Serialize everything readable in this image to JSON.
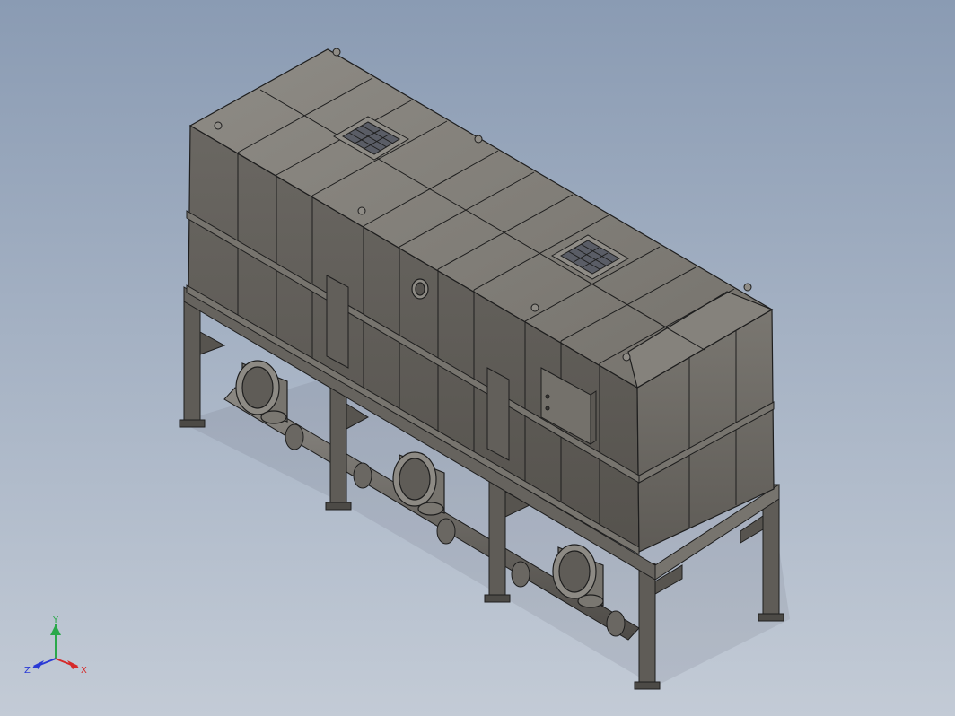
{
  "viewport": {
    "background_top": "#8a9bb3",
    "background_bottom": "#c3cbd6"
  },
  "model": {
    "body_color": "#6e6b66",
    "edge_color": "#1e1e1e"
  },
  "triad": {
    "x_label": "X",
    "y_label": "Y",
    "z_label": "Z",
    "x_color": "#d62a2a",
    "y_color": "#2aa84a",
    "z_color": "#2a3ad6"
  }
}
